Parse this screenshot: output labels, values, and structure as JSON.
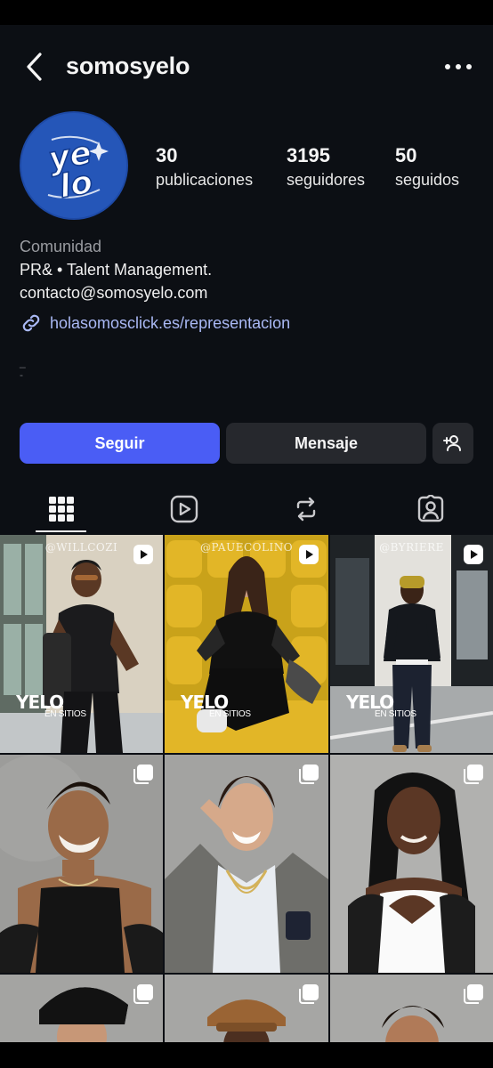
{
  "profile": {
    "username": "somosyelo",
    "avatar_text": "ye lo",
    "stats": {
      "posts": {
        "value": "30",
        "label": "publicaciones"
      },
      "followers": {
        "value": "3195",
        "label": "seguidores"
      },
      "following": {
        "value": "50",
        "label": "seguidos"
      }
    },
    "category": "Comunidad",
    "bio_line1": "PR& • Talent Management.",
    "bio_line2": "contacto@somosyelo.com",
    "link": "holasomosclick.es/representacion",
    "bio_extra1": "_",
    "bio_extra2": "-"
  },
  "actions": {
    "follow_label": "Seguir",
    "message_label": "Mensaje"
  },
  "tabs": [
    {
      "name": "grid-tab",
      "icon": "grid-icon",
      "active": true
    },
    {
      "name": "reels-tab",
      "icon": "reels-icon",
      "active": false
    },
    {
      "name": "reposts-tab",
      "icon": "repost-icon",
      "active": false
    },
    {
      "name": "tagged-tab",
      "icon": "tagged-icon",
      "active": false
    }
  ],
  "posts": [
    {
      "type": "reel",
      "handle": "@WILLCOZI",
      "brand": "YELO",
      "brand_sub": "EN SITIOS"
    },
    {
      "type": "reel",
      "handle": "@PAUECOLINO",
      "brand": "YELO",
      "brand_sub": "EN SITIOS"
    },
    {
      "type": "reel",
      "handle": "@BYRIERE",
      "brand": "YELO",
      "brand_sub": "EN SITIOS"
    },
    {
      "type": "carousel"
    },
    {
      "type": "carousel"
    },
    {
      "type": "carousel"
    },
    {
      "type": "carousel"
    },
    {
      "type": "carousel"
    },
    {
      "type": "carousel"
    }
  ],
  "colors": {
    "background": "#0c0f14",
    "follow_button": "#4a5df5",
    "secondary_button": "#26282d",
    "link": "#aab9f5",
    "avatar": "#2556b8"
  }
}
